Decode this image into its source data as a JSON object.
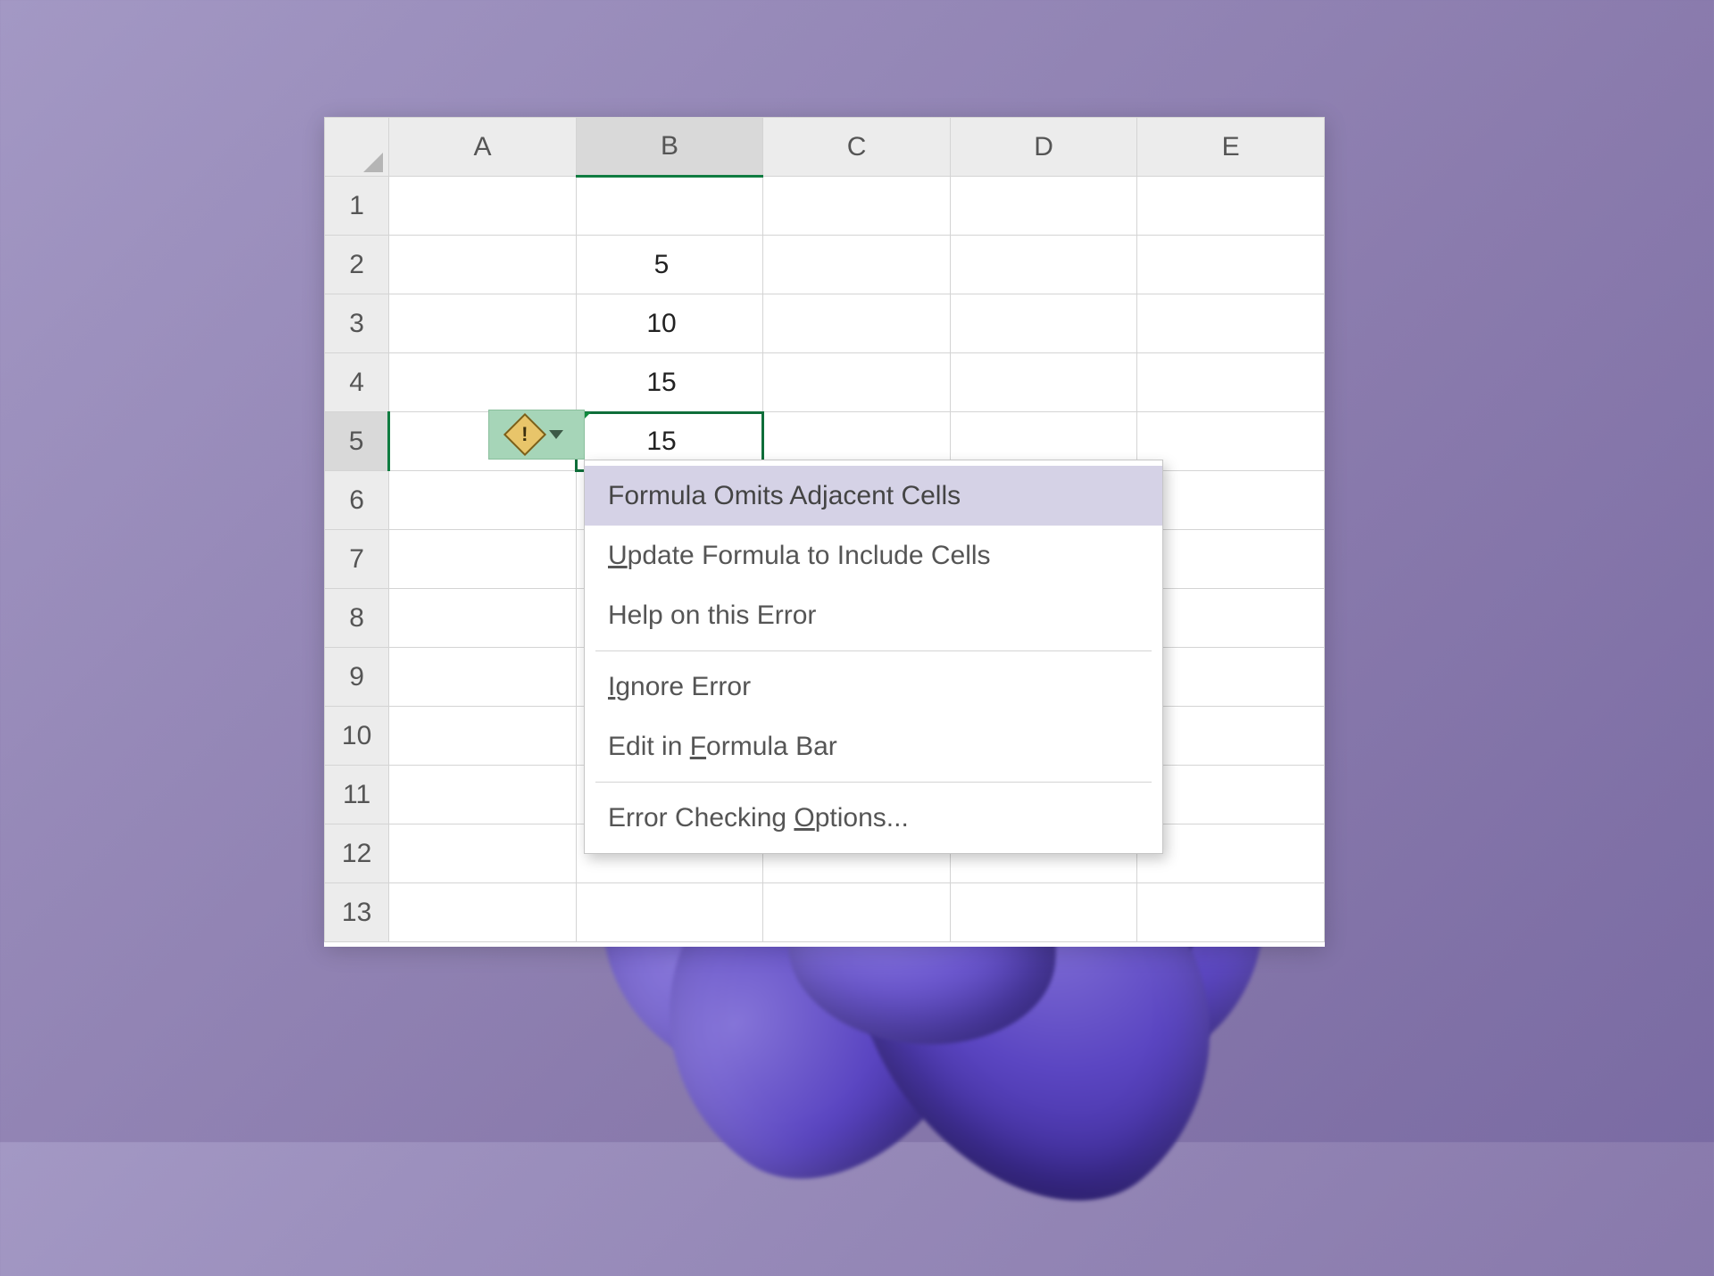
{
  "columns": {
    "A": "A",
    "B": "B",
    "C": "C",
    "D": "D",
    "E": "E"
  },
  "rows": {
    "1": "1",
    "2": "2",
    "3": "3",
    "4": "4",
    "5": "5",
    "6": "6",
    "7": "7",
    "8": "8",
    "9": "9",
    "10": "10",
    "11": "11",
    "12": "12",
    "13": "13"
  },
  "cells": {
    "B2": "5",
    "B3": "10",
    "B4": "15",
    "B5": "15"
  },
  "selected_cell": "B5",
  "error_tag": {
    "icon": "warning-icon",
    "mark": "!"
  },
  "context_menu": {
    "items": [
      {
        "label_parts": [
          "Formula Omits Adjacent Cells"
        ],
        "highlight": true
      },
      {
        "label_parts": [
          "",
          "U",
          "pdate Formula to Include Cells"
        ]
      },
      {
        "label_parts": [
          "Help on this Error"
        ]
      },
      "---",
      {
        "label_parts": [
          "",
          "I",
          "gnore Error"
        ]
      },
      {
        "label_parts": [
          "Edit in ",
          "F",
          "ormula Bar"
        ]
      },
      "---",
      {
        "label_parts": [
          "Error Checking ",
          "O",
          "ptions..."
        ]
      }
    ]
  }
}
